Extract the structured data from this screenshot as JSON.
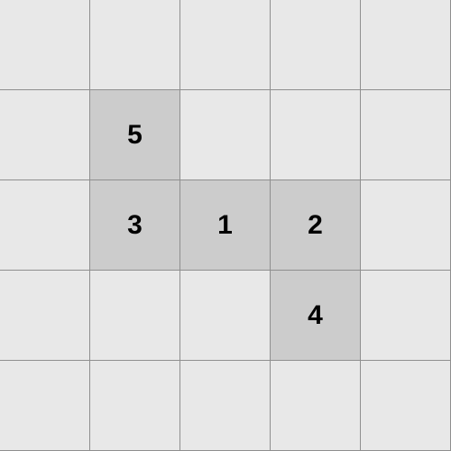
{
  "board": {
    "rows": 5,
    "cols": 5,
    "colors": {
      "empty": "#e8e8e8",
      "filled": "#cccccc",
      "grid_line": "#8f8f8f",
      "text": "#000000"
    },
    "cells": [
      [
        "",
        "",
        "",
        "",
        ""
      ],
      [
        "",
        "5",
        "",
        "",
        ""
      ],
      [
        "",
        "3",
        "1",
        "2",
        ""
      ],
      [
        "",
        "",
        "",
        "4",
        ""
      ],
      [
        "",
        "",
        "",
        "",
        ""
      ]
    ]
  }
}
